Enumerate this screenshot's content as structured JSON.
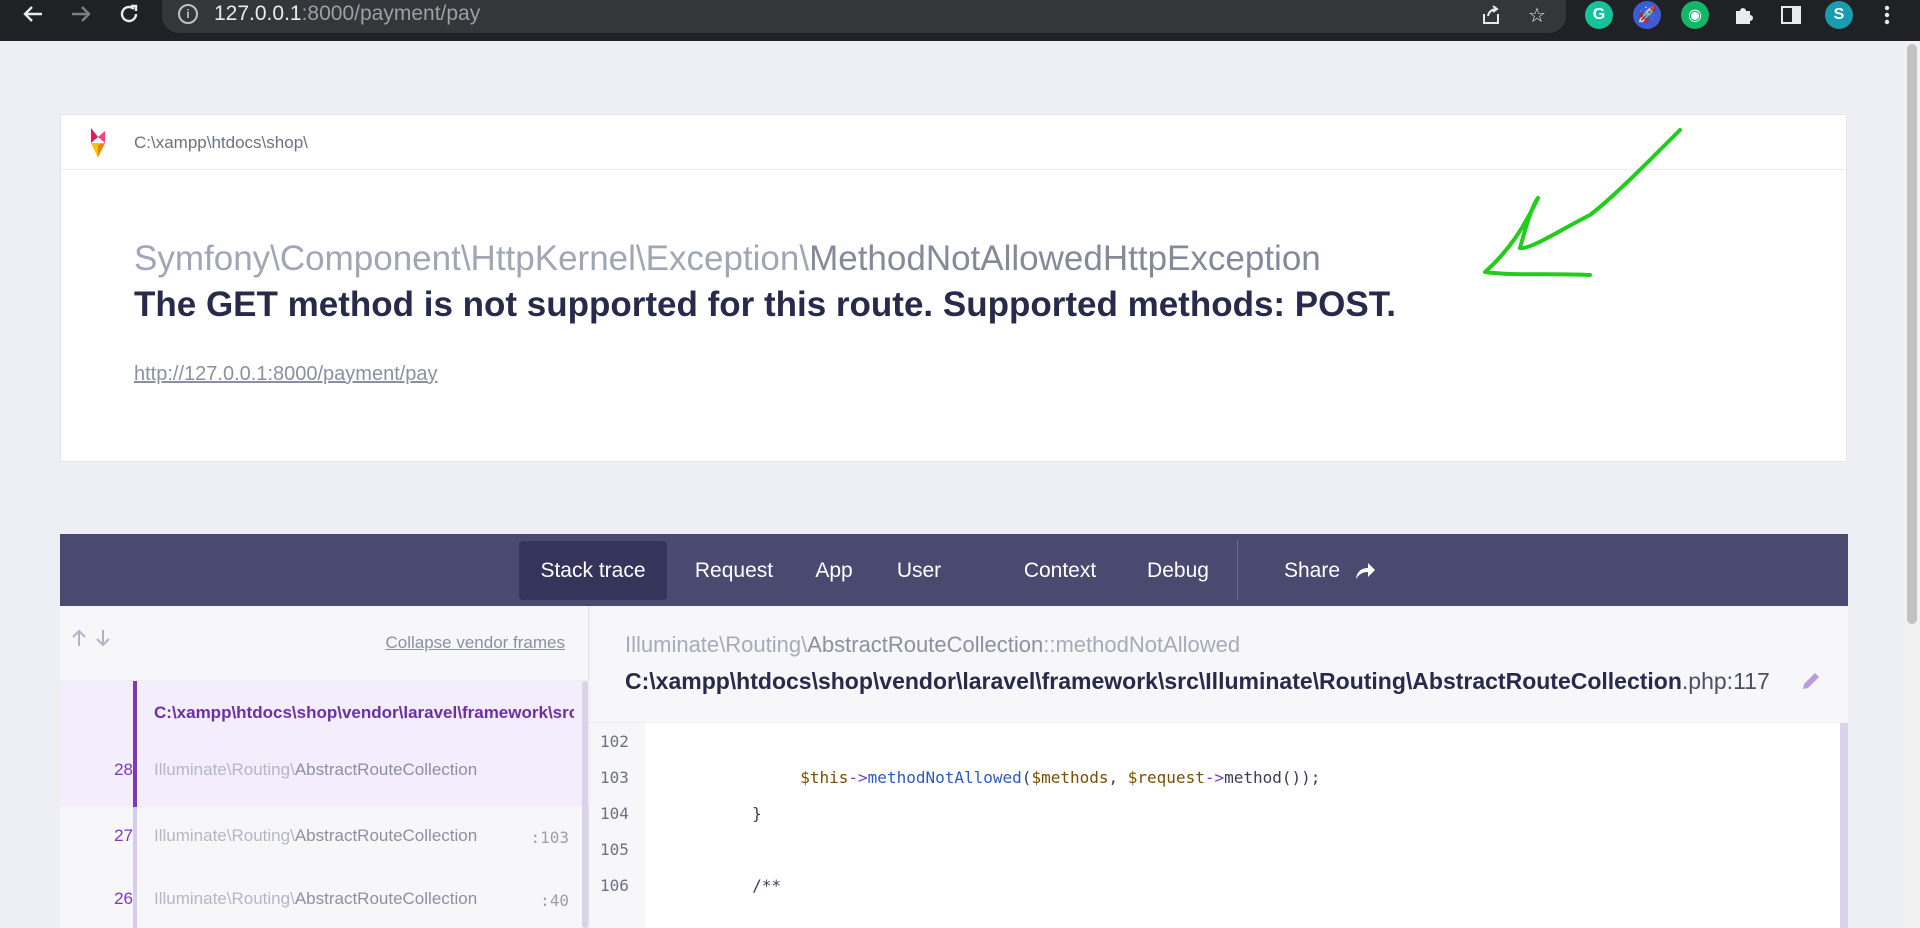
{
  "browser": {
    "url_host": "127.0.0.1",
    "url_rest": ":8000/payment/pay",
    "extensions": [
      {
        "name": "grammarly",
        "label": "G",
        "color": "#15c39a"
      },
      {
        "name": "rocket",
        "label": "🚀",
        "color": "#3c5bd8"
      },
      {
        "name": "vpn",
        "label": "◉",
        "color": "#12b76a"
      }
    ],
    "profile_initial": "S",
    "profile_color": "#1a9bb0"
  },
  "header": {
    "project_path": "C:\\xampp\\htdocs\\shop\\",
    "exception_namespace": "Symfony\\Component\\HttpKernel\\Exception\\",
    "exception_name": "MethodNotAllowedHttpException",
    "message": "The GET method is not supported for this route. Supported methods: POST.",
    "request_url": "http://127.0.0.1:8000/payment/pay"
  },
  "tabs": [
    {
      "label": "Stack trace",
      "active": true
    },
    {
      "label": "Request"
    },
    {
      "label": "App"
    },
    {
      "label": "User"
    },
    {
      "label": "Context"
    },
    {
      "label": "Debug"
    },
    {
      "label": "Share"
    }
  ],
  "stack": {
    "collapse_label": "Collapse vendor frames",
    "frames": [
      {
        "num": "28",
        "file": "C:\\xampp\\htdocs\\shop\\vendor\\laravel\\framework\\src\\Illuminate\\Routing\\AbstractRouteCollection.php",
        "ns": "Illuminate\\Routing\\",
        "cls": "AbstractRouteCollection",
        "line": ""
      },
      {
        "num": "27",
        "ns": "Illuminate\\Routing\\",
        "cls": "AbstractRouteCollection",
        "line": ":103"
      },
      {
        "num": "26",
        "ns": "Illuminate\\Routing\\",
        "cls": "AbstractRouteCollection",
        "line": ":40"
      }
    ]
  },
  "code": {
    "fn_ns": "Illuminate\\Routing\\",
    "fn_class": "AbstractRouteCollection",
    "fn_method": "::methodNotAllowed",
    "file_path": "C:\\xampp\\htdocs\\shop\\vendor\\laravel\\framework\\src\\Illuminate\\Routing\\AbstractRouteCollection",
    "file_ext": ".php:117",
    "lines": [
      {
        "n": "102"
      },
      {
        "n": "103"
      },
      {
        "n": "104",
        "text": "        }"
      },
      {
        "n": "105",
        "text": ""
      },
      {
        "n": "106",
        "text": "        /**"
      }
    ],
    "line103": {
      "indent": "             ",
      "var1": "$this",
      "arrow1": "->",
      "method": "methodNotAllowed",
      "open": "(",
      "var2": "$methods",
      "comma": ", ",
      "var3": "$request",
      "arrow2": "->",
      "call": "method());"
    }
  },
  "annotation_color": "#22cc1a"
}
